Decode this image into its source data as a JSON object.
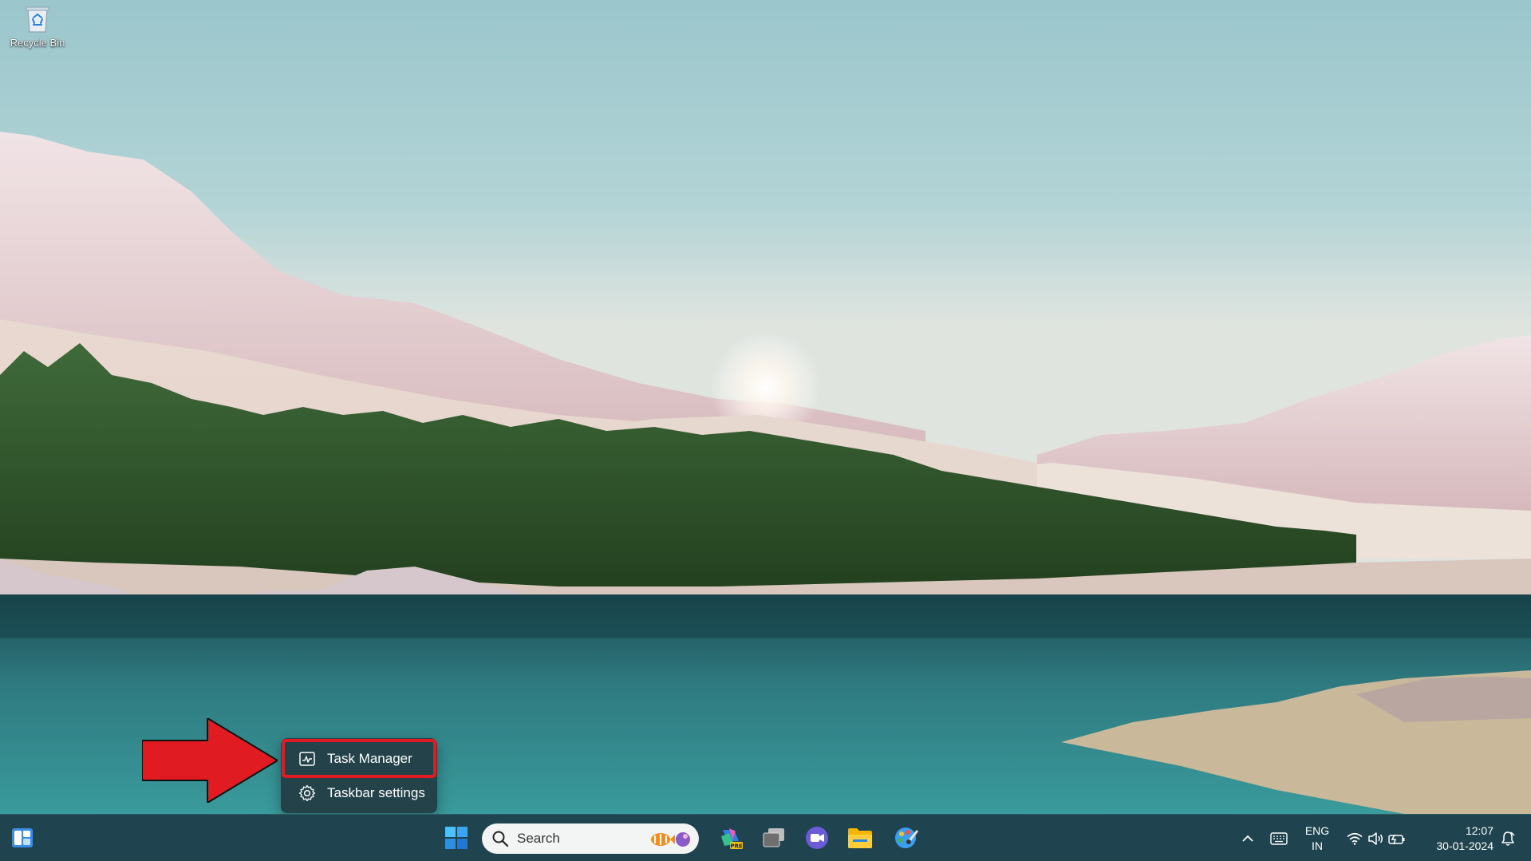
{
  "desktop": {
    "icons": [
      {
        "label": "Recycle Bin",
        "icon": "recycle-bin-icon"
      }
    ]
  },
  "context_menu": {
    "items": [
      {
        "label": "Task Manager",
        "icon": "task-manager-icon",
        "highlighted": true
      },
      {
        "label": "Taskbar settings",
        "icon": "gear-icon",
        "highlighted": false
      }
    ]
  },
  "taskbar": {
    "search_placeholder": "Search",
    "pinned_apps": [
      "copilot-pre-icon",
      "multitasking-icon",
      "video-call-icon",
      "file-explorer-icon",
      "paint-icon"
    ],
    "tray": {
      "language_line1": "ENG",
      "language_line2": "IN",
      "time": "12:07",
      "date": "30-01-2024"
    }
  },
  "colors": {
    "accent_highlight": "#e11b22",
    "taskbar_bg": "#1f4450",
    "menu_bg": "#23424a"
  }
}
